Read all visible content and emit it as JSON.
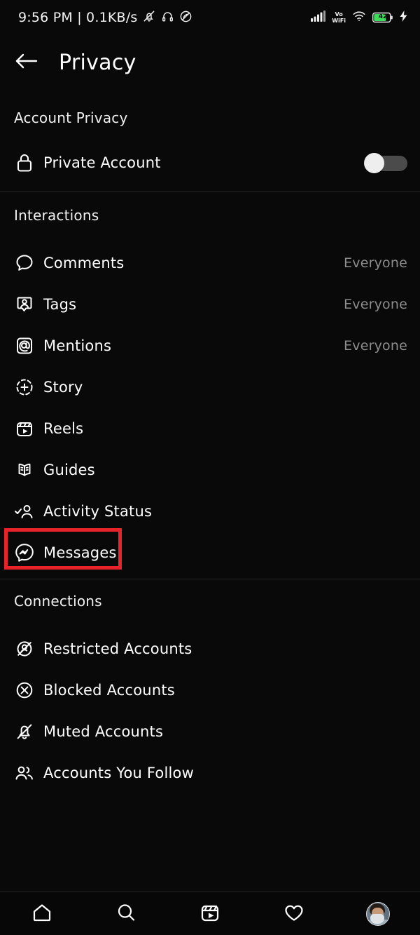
{
  "statusbar": {
    "clock": "9:56 PM | 0.1KB/s",
    "battery_level": "42",
    "network_label": "Vo",
    "network_label2": "WiFi",
    "icons": [
      "bell-mute-icon",
      "headphones-icon",
      "dnd-icon",
      "signal-bars-icon",
      "vowifi-icon",
      "wifi-icon",
      "battery-icon",
      "charging-bolt-icon"
    ]
  },
  "appbar": {
    "back_icon": "back-arrow-icon",
    "title": "Privacy"
  },
  "sections": [
    {
      "header": "Account Privacy",
      "rows": [
        {
          "icon": "lock-icon",
          "label": "Private Account",
          "control": "toggle",
          "toggle_on": false
        }
      ]
    },
    {
      "header": "Interactions",
      "rows": [
        {
          "icon": "comment-bubble-icon",
          "label": "Comments",
          "value": "Everyone"
        },
        {
          "icon": "tag-person-icon",
          "label": "Tags",
          "value": "Everyone"
        },
        {
          "icon": "at-mention-icon",
          "label": "Mentions",
          "value": "Everyone"
        },
        {
          "icon": "story-plus-icon",
          "label": "Story",
          "value": ""
        },
        {
          "icon": "reels-clapper-icon",
          "label": "Reels",
          "value": ""
        },
        {
          "icon": "guides-book-icon",
          "label": "Guides",
          "value": ""
        },
        {
          "icon": "activity-status-icon",
          "label": "Activity Status",
          "value": ""
        },
        {
          "icon": "messenger-icon",
          "label": "Messages",
          "value": "",
          "highlighted": true
        }
      ]
    },
    {
      "header": "Connections",
      "rows": [
        {
          "icon": "restricted-account-icon",
          "label": "Restricted Accounts",
          "value": ""
        },
        {
          "icon": "blocked-account-icon",
          "label": "Blocked Accounts",
          "value": ""
        },
        {
          "icon": "muted-bell-icon",
          "label": "Muted Accounts",
          "value": ""
        },
        {
          "icon": "accounts-you-follow-icon",
          "label": "Accounts You Follow",
          "value": ""
        }
      ]
    }
  ],
  "highlight": {
    "color": "#e8232a"
  },
  "bottomnav": {
    "items": [
      {
        "icon": "home-icon",
        "label": "Home"
      },
      {
        "icon": "search-icon",
        "label": "Search"
      },
      {
        "icon": "reels-icon",
        "label": "Reels"
      },
      {
        "icon": "heart-icon",
        "label": "Activity"
      },
      {
        "icon": "profile-avatar",
        "label": "Profile"
      }
    ]
  },
  "colors": {
    "background": "#090909",
    "text": "#ffffff",
    "muted_text": "#8d8d8d",
    "divider": "#262626",
    "accent_red": "#e8232a",
    "battery_green": "#3ddc5a",
    "toggle_track": "#4b4b4b"
  }
}
